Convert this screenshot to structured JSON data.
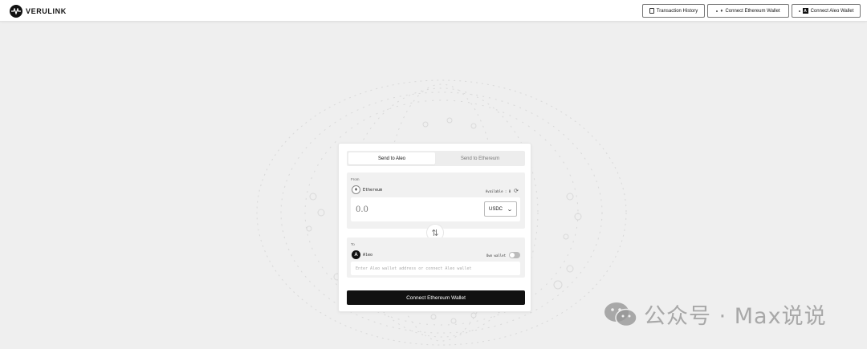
{
  "header": {
    "brand": "VERULINK",
    "buttons": {
      "history": "Transaction History",
      "connect_eth": "Connect Ethereum Wallet",
      "connect_aleo": "Connect Aleo Wallet"
    }
  },
  "tabs": {
    "send_to_aleo": "Send to Aleo",
    "send_to_ethereum": "Send to Ethereum",
    "active": "send_to_aleo"
  },
  "from": {
    "label": "From",
    "chain": "Ethereum",
    "available": "Available : 0",
    "amount_placeholder": "0.0",
    "token": "USDC"
  },
  "to": {
    "label": "To",
    "chain": "Aleo",
    "own_wallet_label": "Own wallet",
    "own_wallet_on": false,
    "address_placeholder": "Enter Aleo wallet address or connect Aleo wallet"
  },
  "action": {
    "connect_label": "Connect Ethereum Wallet"
  },
  "watermark": {
    "text": "公众号 · Max说说"
  },
  "colors": {
    "background": "#efefef",
    "primary": "#111111",
    "panel": "#f1f1f1"
  }
}
